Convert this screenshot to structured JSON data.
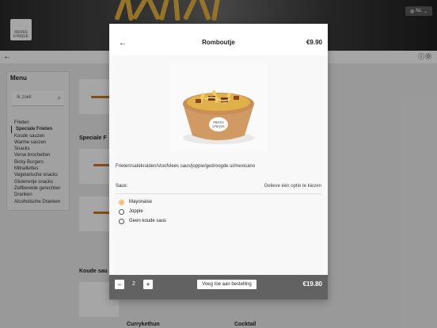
{
  "header": {
    "brand": [
      "FRITES",
      "UNIQUE"
    ],
    "language": "NL"
  },
  "sidebar": {
    "title": "Menu",
    "search_placeholder": "Ik zoek",
    "items": [
      "Frieten",
      "Speciale Frieten",
      "Koude sauzen",
      "Warme sauzen",
      "Snacks",
      "Verse brochetten",
      "Bicky Burgers",
      "Mitraillettes",
      "Vegetarische snacks",
      "Glutenvrije snacks",
      "Zelfbereide gerechten",
      "Dranken",
      "Alcoholische Dranken"
    ],
    "active_index": 1
  },
  "background": {
    "section1": "Speciale F",
    "section2": "Koude sau",
    "item1": "Currykethun",
    "item2": "Cocktail"
  },
  "modal": {
    "title": "Romboutje",
    "price": "€9.90",
    "description": "Frieten/satékruiden/stoofvlees saus/joppie/gedroogde ui/mexicano",
    "sauce_label": "Saus:",
    "sauce_hint": "Gelieve één optie te kiezen",
    "options": [
      "Mayonaise",
      "Joppie",
      "Geen koude saus"
    ],
    "selected_option": 0,
    "quantity": "2",
    "minus": "−",
    "plus": "+",
    "add_button": "Voeg toe aan bestelling",
    "total": "€19.80",
    "bowl_label": [
      "FRITES",
      "UNIQUE"
    ]
  },
  "colors": {
    "accent": "#f2b868",
    "footer": "#626262"
  }
}
